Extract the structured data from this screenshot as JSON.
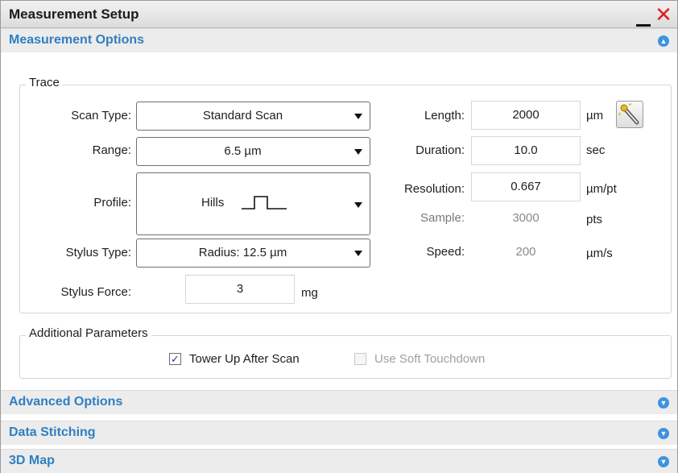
{
  "window": {
    "title": "Measurement Setup",
    "minimize_icon": "minimize-icon",
    "close_icon": "close-icon"
  },
  "sections": {
    "measurement_options": "Measurement Options",
    "advanced_options": "Advanced Options",
    "data_stitching": "Data Stitching",
    "map_3d": "3D Map"
  },
  "trace": {
    "legend": "Trace",
    "scan_type": {
      "label": "Scan Type:",
      "value": "Standard Scan"
    },
    "range": {
      "label": "Range:",
      "value": "6.5 µm"
    },
    "profile": {
      "label": "Profile:",
      "value": "Hills"
    },
    "stylus_type": {
      "label": "Stylus Type:",
      "value": "Radius: 12.5 µm"
    },
    "stylus_force": {
      "label": "Stylus Force:",
      "value": "3",
      "unit": "mg"
    },
    "length": {
      "label": "Length:",
      "value": "2000",
      "unit": "µm"
    },
    "duration": {
      "label": "Duration:",
      "value": "10.0",
      "unit": "sec"
    },
    "resolution": {
      "label": "Resolution:",
      "value": "0.667",
      "unit": "µm/pt"
    },
    "sample": {
      "label": "Sample:",
      "value": "3000",
      "unit": "pts"
    },
    "speed": {
      "label": "Speed:",
      "value": "200",
      "unit": "µm/s"
    }
  },
  "additional": {
    "legend": "Additional Parameters",
    "tower_up": {
      "label": "Tower Up After Scan",
      "checked": true
    },
    "soft_touchdown": {
      "label": "Use Soft Touchdown",
      "checked": false,
      "disabled": true
    }
  },
  "colors": {
    "accent": "#2f7fc1",
    "close": "#e02020",
    "disabled_text": "#a0a0a0"
  }
}
